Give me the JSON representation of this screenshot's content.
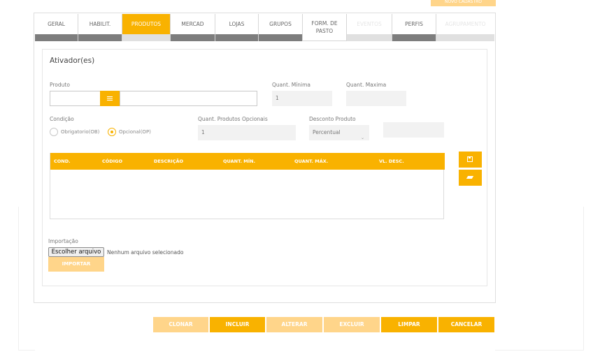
{
  "top_button": {
    "label": "NOVO CADASTRO"
  },
  "tabs": [
    {
      "label": "GERAL",
      "state": "normal"
    },
    {
      "label": "HABILIT.",
      "state": "normal"
    },
    {
      "label": "PRODUTOS",
      "state": "active"
    },
    {
      "label": "MERCAD",
      "state": "normal"
    },
    {
      "label": "LOJAS",
      "state": "normal"
    },
    {
      "label": "GRUPOS",
      "state": "normal"
    },
    {
      "label": "FORM. DE PASTO",
      "state": "plain"
    },
    {
      "label": "EVENTOS",
      "state": "disabled"
    },
    {
      "label": "PERFIS",
      "state": "normal"
    },
    {
      "label": "AGRUPAMENTO",
      "state": "disabled"
    }
  ],
  "section": {
    "title": "Ativador(es)",
    "produto": {
      "label": "Produto",
      "value": "",
      "button_icon": "list-icon"
    },
    "quant_minima": {
      "label": "Quant. Mínima",
      "value": "1"
    },
    "quant_maxima": {
      "label": "Quant. Maxima",
      "value": ""
    },
    "condicao": {
      "label": "Condição",
      "options": [
        {
          "label": "Obrigatorio(OB)",
          "selected": false
        },
        {
          "label": "Opcional(OP)",
          "selected": true
        }
      ]
    },
    "quant_opcionais": {
      "label": "Quant. Produtos Opcionais",
      "value": "1"
    },
    "desconto": {
      "label": "Desconto Produto",
      "selected": "Percentual",
      "value": ""
    },
    "table": {
      "columns": [
        "COND.",
        "CÓDIGO",
        "DESCRIÇÃO",
        "QUANT. MÍN.",
        "QUANT. MÁX.",
        "VL. DESC."
      ],
      "rows": []
    },
    "side_buttons": {
      "save_icon": "save-icon",
      "clear_icon": "eraser-icon"
    },
    "importacao": {
      "label": "Importação",
      "file_button": "Escolher arquivo",
      "file_status": "Nenhum arquivo selecionado",
      "import_button": "IMPORTAR"
    }
  },
  "actions": [
    {
      "label": "CLONAR",
      "enabled": false
    },
    {
      "label": "INCLUIR",
      "enabled": true
    },
    {
      "label": "ALTERAR",
      "enabled": false
    },
    {
      "label": "EXCLUIR",
      "enabled": false
    },
    {
      "label": "LIMPAR",
      "enabled": true
    },
    {
      "label": "CANCELAR",
      "enabled": true
    }
  ],
  "colors": {
    "accent": "#f9b200",
    "accent_disabled": "#ffd58a",
    "tab_bar": "#7d7d7d"
  }
}
